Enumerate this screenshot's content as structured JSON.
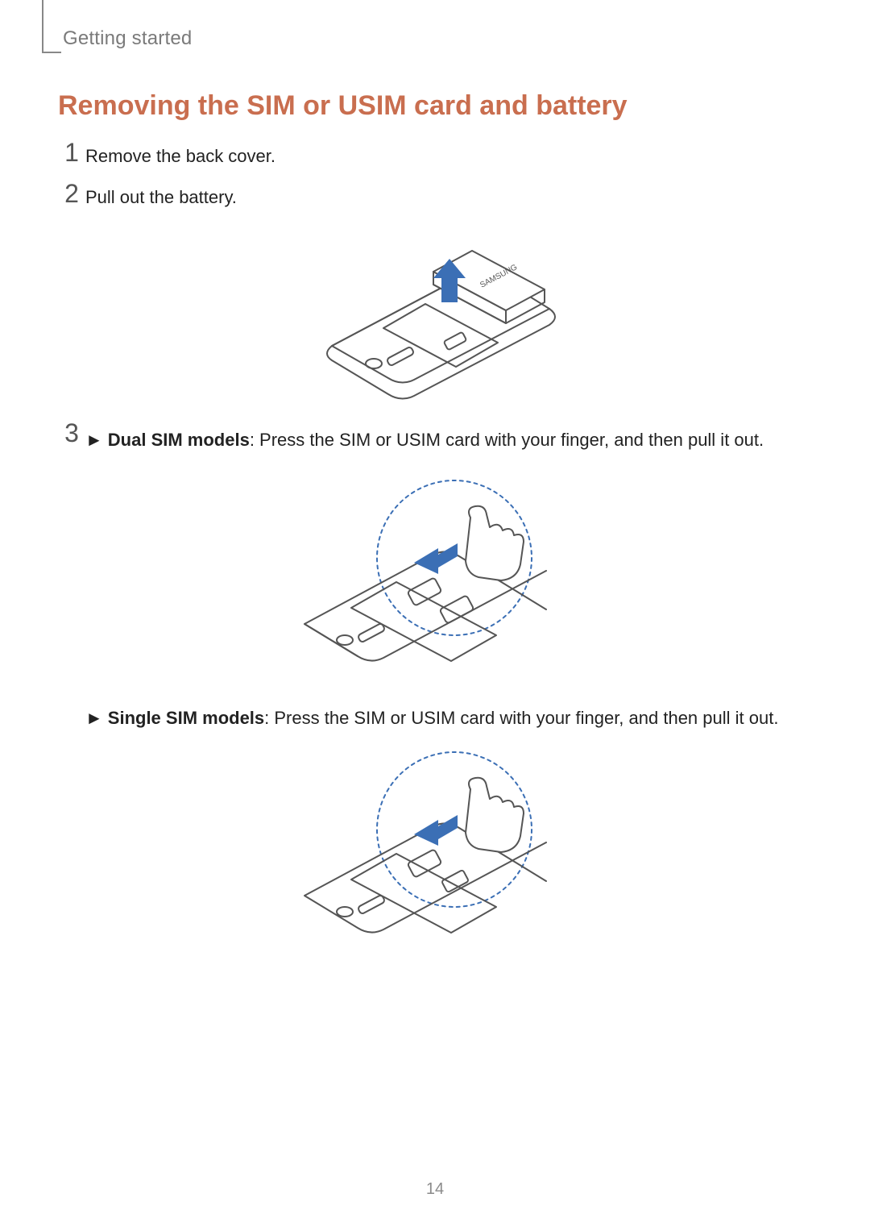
{
  "header": {
    "section": "Getting started"
  },
  "title": "Removing the SIM or USIM card and battery",
  "steps": {
    "s1_num": "1",
    "s1_text": "Remove the back cover.",
    "s2_num": "2",
    "s2_text": "Pull out the battery.",
    "s3_num": "3",
    "s3a_bullet": "►",
    "s3a_bold": "Dual SIM models",
    "s3a_rest": ": Press the SIM or USIM card with your finger, and then pull it out.",
    "s3b_bullet": "►",
    "s3b_bold": "Single SIM models",
    "s3b_rest": ": Press the SIM or USIM card with your finger, and then pull it out."
  },
  "page_number": "14"
}
